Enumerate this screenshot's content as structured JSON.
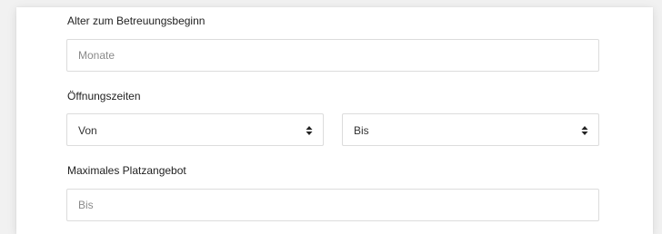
{
  "form": {
    "age": {
      "label": "Alter zum Betreuungsbeginn",
      "placeholder": "Monate",
      "value": ""
    },
    "hours": {
      "label": "Öffnungszeiten",
      "from": {
        "value": "Von",
        "icon": "sort-arrows-icon"
      },
      "to": {
        "value": "Bis",
        "icon": "sort-arrows-icon"
      }
    },
    "capacity": {
      "label": "Maximales Platzangebot",
      "placeholder": "Bis",
      "value": ""
    }
  }
}
